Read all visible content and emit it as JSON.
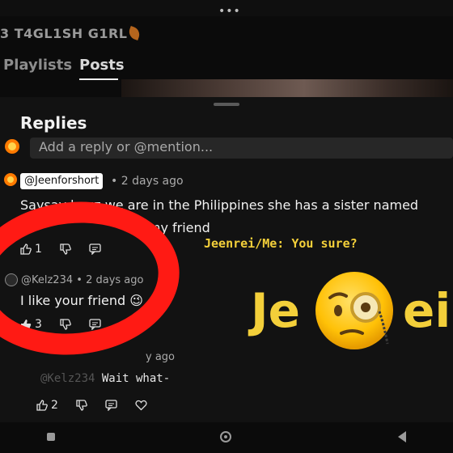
{
  "status": {
    "dots": "•••"
  },
  "channel": {
    "name": "3 T4GL1SH G1RL"
  },
  "tabs": [
    {
      "label": "Playlists"
    },
    {
      "label": "Posts"
    }
  ],
  "replies": {
    "title": "Replies",
    "input_placeholder": "Add a reply or @mention..."
  },
  "comments": [
    {
      "author": "@Jeenforshort",
      "time": "• 2 days ago",
      "text_line1": "Saysay bcuz we are in the Philippines she has a sister named",
      "text_line2": "o my friend",
      "likes": "1"
    },
    {
      "author": "@Kelz234",
      "time": "• 2 days ago",
      "text": "I like your friend 😉",
      "likes": "3"
    },
    {
      "time": "y ago",
      "text": "Wait what-",
      "likes": "2"
    }
  ],
  "overlay": {
    "caption": "Jeenrei/Me: You sure?",
    "big_left": "Je",
    "big_right": "ei"
  },
  "colors": {
    "accent_red": "#ff1a14",
    "caption_yellow": "#f3cf3a",
    "avatar_orange": "#ff7a00"
  }
}
